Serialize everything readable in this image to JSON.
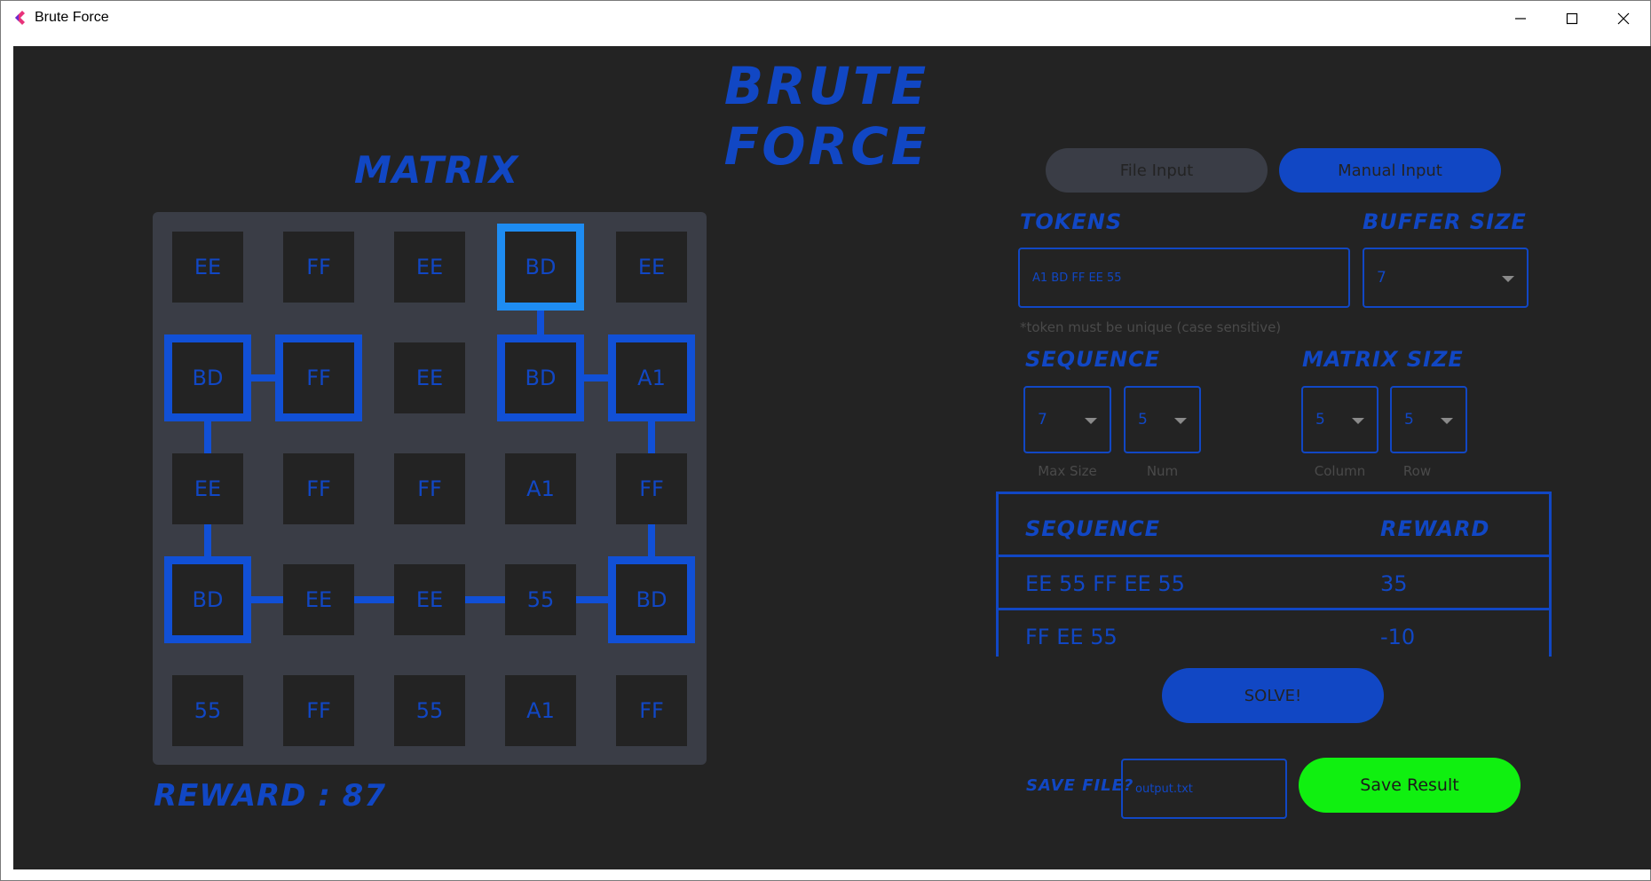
{
  "window": {
    "title": "Brute Force",
    "icon": "app-logo-icon",
    "controls": [
      "minimize-icon",
      "maximize-icon",
      "close-icon"
    ]
  },
  "app": {
    "title": "BRUTE FORCE"
  },
  "matrix": {
    "heading": "MATRIX",
    "rows": [
      [
        "EE",
        "FF",
        "EE",
        "BD",
        "EE"
      ],
      [
        "BD",
        "FF",
        "EE",
        "BD",
        "A1"
      ],
      [
        "EE",
        "FF",
        "FF",
        "A1",
        "FF"
      ],
      [
        "BD",
        "EE",
        "EE",
        "55",
        "BD"
      ],
      [
        "55",
        "FF",
        "55",
        "A1",
        "FF"
      ]
    ],
    "path": [
      [
        0,
        3
      ],
      [
        1,
        3
      ],
      [
        1,
        4
      ],
      [
        3,
        4
      ],
      [
        3,
        0
      ],
      [
        1,
        0
      ],
      [
        1,
        1
      ]
    ],
    "reward_label": "REWARD : 87"
  },
  "tabs": {
    "file_input": "File Input",
    "manual_input": "Manual Input",
    "active": "manual_input"
  },
  "tokens": {
    "heading": "TOKENS",
    "value": "A1 BD FF EE 55",
    "hint": "*token must be unique (case sensitive)"
  },
  "buffer": {
    "heading": "BUFFER SIZE",
    "value": "7"
  },
  "sequence": {
    "heading": "SEQUENCE",
    "max_size": "7",
    "max_size_caption": "Max Size",
    "num": "5",
    "num_caption": "Num"
  },
  "matrix_size": {
    "heading": "MATRIX SIZE",
    "column": "5",
    "column_caption": "Column",
    "row": "5",
    "row_caption": "Row"
  },
  "sequence_table": {
    "col_sequence": "SEQUENCE",
    "col_reward": "REWARD",
    "rows": [
      {
        "sequence": "EE 55 FF EE 55",
        "reward": "35"
      },
      {
        "sequence": "FF EE 55",
        "reward": "-10"
      }
    ]
  },
  "actions": {
    "solve": "SOLVE!",
    "save_label": "SAVE FILE?",
    "save_filename": "output.txt",
    "save_button": "Save Result"
  },
  "colors": {
    "accent": "#1147c4",
    "path": "#1150d6",
    "start": "#1e8cf2",
    "save": "#10f010",
    "background": "#232323",
    "panel": "#3a3d46"
  }
}
